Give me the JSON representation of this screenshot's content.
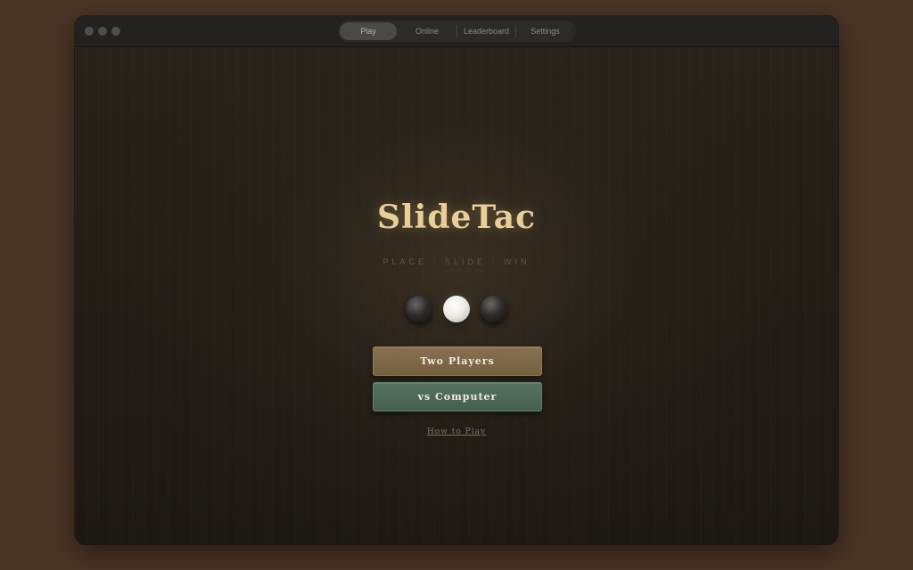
{
  "window": {
    "tabs": [
      {
        "label": "Play",
        "active": true
      },
      {
        "label": "Online",
        "active": false
      },
      {
        "label": "Leaderboard",
        "active": false
      },
      {
        "label": "Settings",
        "active": false
      }
    ]
  },
  "game": {
    "title": "SlideTac",
    "subtitle": "PLACE · SLIDE · WIN",
    "stones": [
      "black",
      "white",
      "black"
    ],
    "buttons": {
      "two_players": "Two Players",
      "vs_computer": "vs Computer"
    },
    "how_to_play": "How to Play"
  },
  "colors": {
    "title": "#e8cf98",
    "two_players_button": "#7d6748",
    "vs_computer_button": "#4e6957",
    "desktop_background": "#4a3426"
  },
  "icons": {
    "traffic_lights": [
      "close-icon",
      "minimize-icon",
      "zoom-icon"
    ]
  }
}
